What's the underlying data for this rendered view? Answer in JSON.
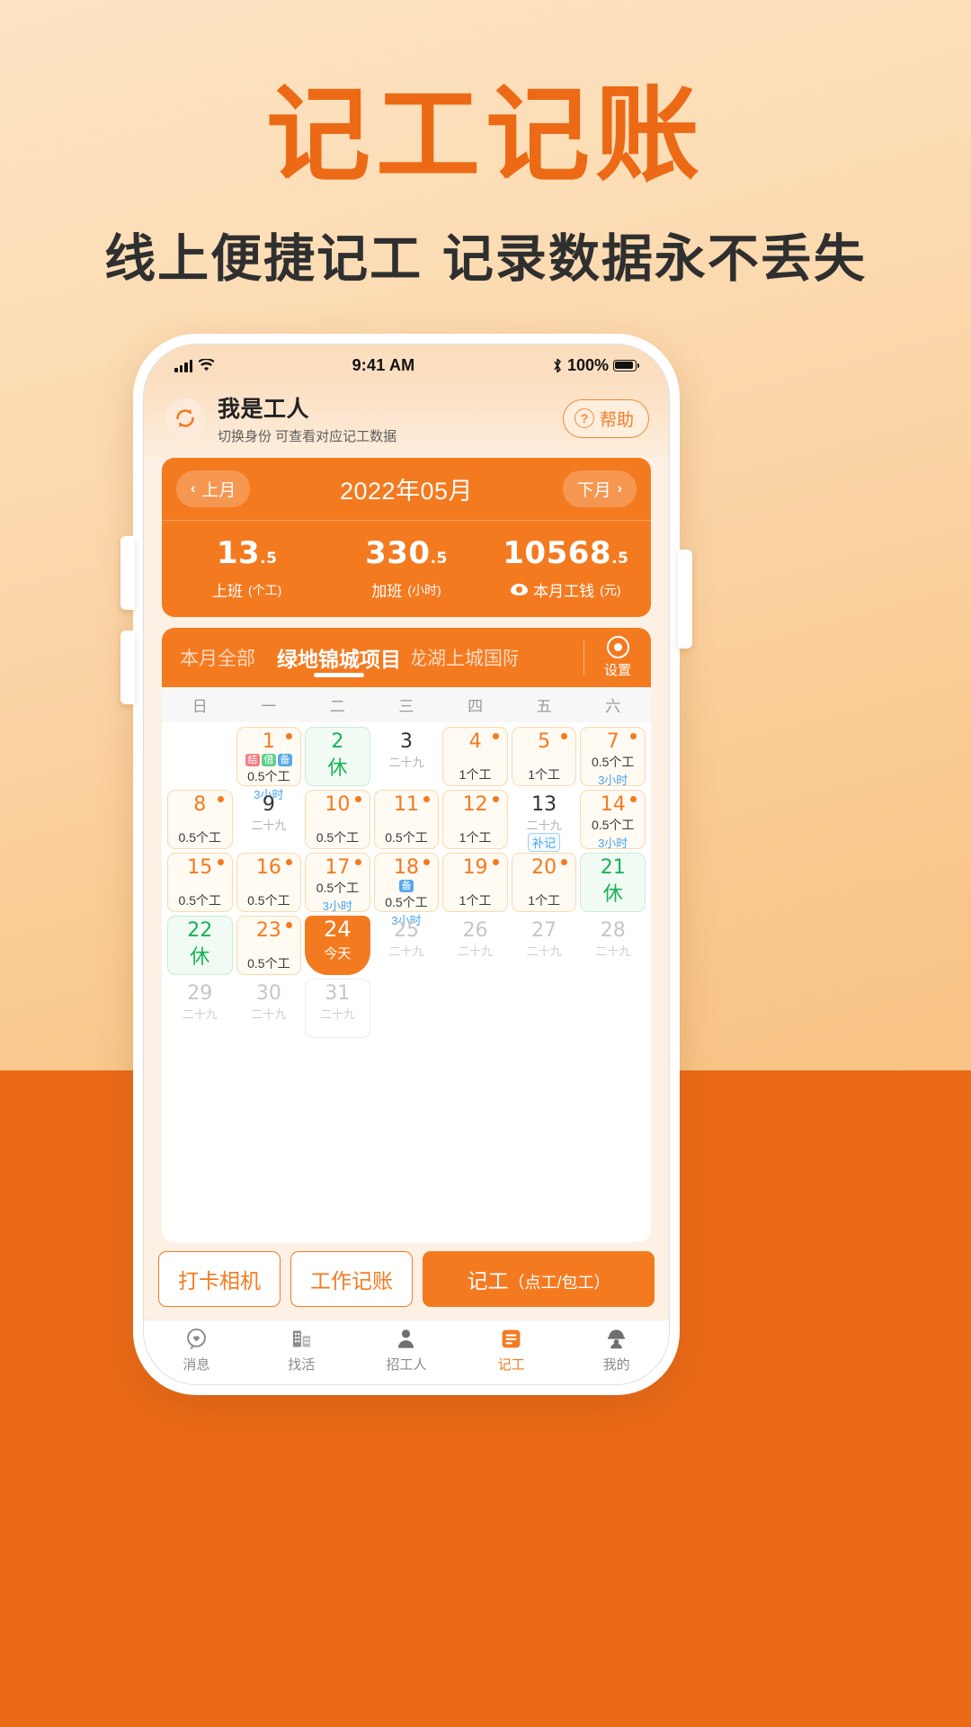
{
  "promo": {
    "title": "记工记账",
    "subtitle": "线上便捷记工 记录数据永不丢失"
  },
  "status_bar": {
    "time": "9:41 AM",
    "battery": "100%",
    "bluetooth_icon": "bluetooth-icon"
  },
  "header": {
    "switch_icon": "refresh-switch-icon",
    "identity": "我是工人",
    "description": "切换身份 可查看对应记工数据",
    "help_label": "帮助",
    "help_icon": "question-circle-icon"
  },
  "summary": {
    "prev_label": "上月",
    "next_label": "下月",
    "month": "2022年05月",
    "stats": [
      {
        "value": "13",
        "decimal": ".5",
        "label": "上班",
        "unit": "(个工)",
        "icon": ""
      },
      {
        "value": "330",
        "decimal": ".5",
        "label": "加班",
        "unit": "(小时)",
        "icon": ""
      },
      {
        "value": "10568",
        "decimal": ".5",
        "label": "本月工钱",
        "unit": "(元)",
        "icon": "eye-icon"
      }
    ]
  },
  "tabs": {
    "items": [
      {
        "label": "本月全部",
        "active": false
      },
      {
        "label": "绿地锦城项目",
        "active": true
      },
      {
        "label": "龙湖上城国际",
        "active": false
      }
    ],
    "settings_label": "设置",
    "settings_icon": "target-gear-icon"
  },
  "calendar": {
    "weekdays": [
      "日",
      "一",
      "二",
      "三",
      "四",
      "五",
      "六"
    ],
    "cells": [
      {
        "type": "blank"
      },
      {
        "day": "1",
        "style": "work",
        "dot": true,
        "tags": [
          "结",
          "借",
          "备"
        ],
        "amount": "0.5个工",
        "hours": "3小时"
      },
      {
        "day": "2",
        "style": "rest",
        "rest": "休"
      },
      {
        "day": "3",
        "style": "plain",
        "lunar": "二十九"
      },
      {
        "day": "4",
        "style": "work",
        "dot": true,
        "amount": "1个工"
      },
      {
        "day": "5",
        "style": "work",
        "dot": true,
        "amount": "1个工"
      },
      {
        "day": "7",
        "style": "work",
        "dot": true,
        "amount": "0.5个工",
        "hours": "3小时"
      },
      {
        "day": "8",
        "style": "work",
        "dot": true,
        "amount": "0.5个工"
      },
      {
        "day": "9",
        "style": "plain",
        "lunar": "二十九"
      },
      {
        "day": "10",
        "style": "work",
        "dot": true,
        "amount": "0.5个工"
      },
      {
        "day": "11",
        "style": "work",
        "dot": true,
        "amount": "0.5个工"
      },
      {
        "day": "12",
        "style": "work",
        "dot": true,
        "amount": "1个工"
      },
      {
        "day": "13",
        "style": "plain",
        "lunar": "二十九",
        "badge": "补记"
      },
      {
        "day": "14",
        "style": "work",
        "dot": true,
        "amount": "0.5个工",
        "hours": "3小时"
      },
      {
        "day": "15",
        "style": "work",
        "dot": true,
        "amount": "0.5个工"
      },
      {
        "day": "16",
        "style": "work",
        "dot": true,
        "amount": "0.5个工"
      },
      {
        "day": "17",
        "style": "work",
        "dot": true,
        "amount": "0.5个工",
        "hours": "3小时"
      },
      {
        "day": "18",
        "style": "work",
        "dot": true,
        "tags": [
          "备"
        ],
        "amount": "0.5个工",
        "hours": "3小时"
      },
      {
        "day": "19",
        "style": "work",
        "dot": true,
        "amount": "1个工"
      },
      {
        "day": "20",
        "style": "work",
        "dot": true,
        "amount": "1个工"
      },
      {
        "day": "21",
        "style": "rest",
        "rest": "休"
      },
      {
        "day": "22",
        "style": "rest",
        "rest": "休"
      },
      {
        "day": "23",
        "style": "work",
        "dot": true,
        "amount": "0.5个工"
      },
      {
        "day": "24",
        "style": "today",
        "today_label": "今天"
      },
      {
        "day": "25",
        "style": "muted",
        "lunar": "二十九"
      },
      {
        "day": "26",
        "style": "muted",
        "lunar": "二十九"
      },
      {
        "day": "27",
        "style": "muted",
        "lunar": "二十九"
      },
      {
        "day": "28",
        "style": "muted",
        "lunar": "二十九"
      },
      {
        "day": "29",
        "style": "muted",
        "lunar": "二十九"
      },
      {
        "day": "30",
        "style": "muted",
        "lunar": "二十九"
      },
      {
        "day": "31",
        "style": "muted-box",
        "lunar": "二十九"
      },
      {
        "type": "blank"
      },
      {
        "type": "blank"
      },
      {
        "type": "blank"
      },
      {
        "type": "blank"
      }
    ]
  },
  "actions": [
    {
      "label": "打卡相机",
      "primary": false
    },
    {
      "label": "工作记账",
      "primary": false
    },
    {
      "label": "记工",
      "suffix": "（点工/包工）",
      "primary": true
    }
  ],
  "bottom_nav": [
    {
      "label": "消息",
      "icon": "message-heart-icon",
      "active": false
    },
    {
      "label": "找活",
      "icon": "building-icon",
      "active": false
    },
    {
      "label": "招工人",
      "icon": "person-icon",
      "active": false
    },
    {
      "label": "记工",
      "icon": "notebook-icon",
      "active": true
    },
    {
      "label": "我的",
      "icon": "helmet-person-icon",
      "active": false
    }
  ],
  "colors": {
    "brand": "#f47a20",
    "accent": "#ec6a16",
    "rest": "#17b357",
    "hours": "#46a5f2"
  }
}
